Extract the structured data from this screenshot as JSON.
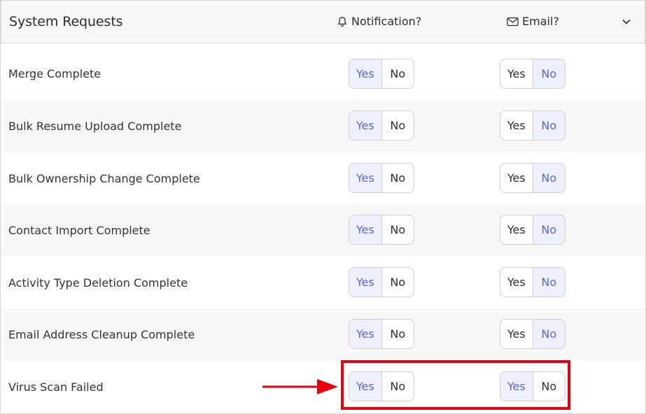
{
  "header": {
    "title": "System Requests",
    "notification_label": "Notification?",
    "email_label": "Email?"
  },
  "options": {
    "yes": "Yes",
    "no": "No"
  },
  "rows": [
    {
      "label": "Merge Complete",
      "notification": "Yes",
      "email": "No"
    },
    {
      "label": "Bulk Resume Upload Complete",
      "notification": "Yes",
      "email": "No"
    },
    {
      "label": "Bulk Ownership Change Complete",
      "notification": "Yes",
      "email": "No"
    },
    {
      "label": "Contact Import Complete",
      "notification": "Yes",
      "email": "No"
    },
    {
      "label": "Activity Type Deletion Complete",
      "notification": "Yes",
      "email": "No"
    },
    {
      "label": "Email Address Cleanup Complete",
      "notification": "Yes",
      "email": "No"
    },
    {
      "label": "Virus Scan Failed",
      "notification": "Yes",
      "email": "Yes"
    }
  ],
  "colors": {
    "active_text": "#5865d6",
    "active_bg": "#eef1fd",
    "highlight": "#e8000d"
  }
}
